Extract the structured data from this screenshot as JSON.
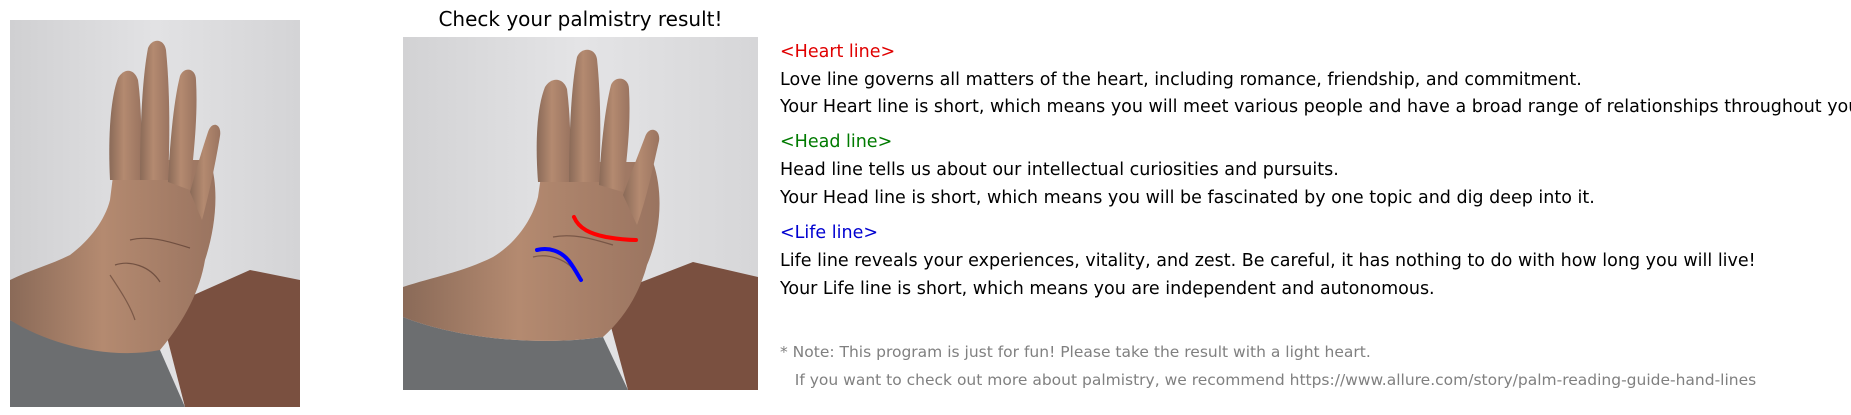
{
  "result_title": "Check your palmistry result!",
  "sections": [
    {
      "id": "heart",
      "title": "<Heart line>",
      "color": "#e00000",
      "description": "Love line governs all matters of the heart, including romance, friendship, and commitment.",
      "result": "Your Heart line is short, which means you will meet various people and have a broad range of relationships throughout your life."
    },
    {
      "id": "head",
      "title": "<Head line>",
      "color": "#007a00",
      "description": "Head line tells us about our intellectual curiosities and pursuits.",
      "result": "Your Head line is short, which means you will be fascinated by one topic and dig deep into it."
    },
    {
      "id": "life",
      "title": "<Life line>",
      "color": "#0000d0",
      "description": "Life line reveals your experiences, vitality, and zest. Be careful, it has nothing to do with how long you will live!",
      "result": "Your Life line is short, which means you are independent and autonomous."
    }
  ],
  "note": {
    "line1": "* Note: This program is just for fun! Please take the result with a light heart.",
    "line2": "   If you want to check out more about palmistry, we recommend https://www.allure.com/story/palm-reading-guide-hand-lines",
    "color": "#808080"
  },
  "overlay_colors": {
    "heart_line": "#ff0000",
    "life_line": "#0000ff"
  }
}
